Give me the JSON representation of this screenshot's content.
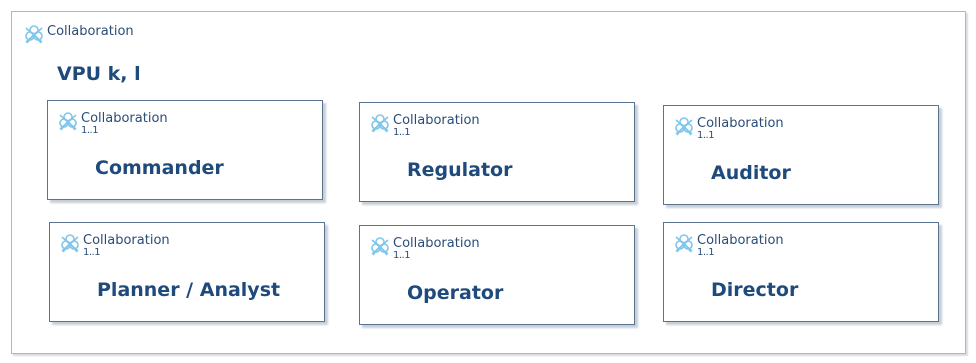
{
  "container": {
    "stereotype": "Collaboration",
    "title": "VPU k, l"
  },
  "parts": [
    {
      "stereotype": "Collaboration",
      "multiplicity": "1..1",
      "name": "Commander"
    },
    {
      "stereotype": "Collaboration",
      "multiplicity": "1..1",
      "name": "Regulator"
    },
    {
      "stereotype": "Collaboration",
      "multiplicity": "1..1",
      "name": "Auditor"
    },
    {
      "stereotype": "Collaboration",
      "multiplicity": "1..1",
      "name": "Planner / Analyst"
    },
    {
      "stereotype": "Collaboration",
      "multiplicity": "1..1",
      "name": "Operator"
    },
    {
      "stereotype": "Collaboration",
      "multiplicity": "1..1",
      "name": "Director"
    }
  ],
  "colors": {
    "icon": "#7fc6ea",
    "text": "#1f4a7c",
    "border": "#5a7392"
  },
  "icons": {
    "collaboration": "collaboration-icon"
  }
}
